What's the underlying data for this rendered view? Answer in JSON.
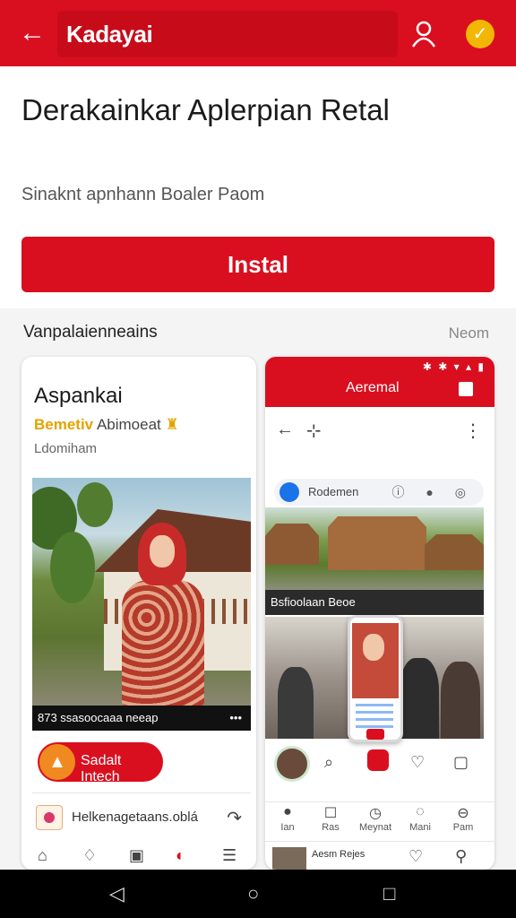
{
  "topbar": {
    "back_icon": "arrow-left-icon",
    "search_text": "Kadayai",
    "user_icon": "user-icon",
    "badge_icon": "check-badge-icon",
    "color": "#d90f1f"
  },
  "header": {
    "title": "Derakainkar Aplerpian Retal",
    "subtitle": "Sinaknt apnhann Boaler Paom",
    "install_label": "Instal"
  },
  "section": {
    "heading": "Vanpalaienneains",
    "more": "Neom"
  },
  "left_card": {
    "title": "Aspankai",
    "tag_gold": "Bemetiv",
    "tag_plain": "Abimoeat",
    "sub": "Ldomiham",
    "caption": "873 ssasoocaaa neeap",
    "caption_menu": "•••",
    "button_label": "Sadalt Intech",
    "link_text": "Helkenagetaans.oblá",
    "share_icon": "share-icon",
    "nav_icons": [
      "home-icon",
      "leaf-icon",
      "box-icon",
      "notification-icon",
      "menu-icon"
    ]
  },
  "right_card": {
    "status": "✱ ✱ ▾ ▴ ▮",
    "title": "Aeremal",
    "bar_back": "←",
    "bar_pin": "⊹",
    "bar_more": "⋮",
    "search_text": "Rodemen",
    "search_icons": "ⓘ ● ◎",
    "caption": "Bsfioolaan Beoe",
    "nav": [
      {
        "icon": "●",
        "label": "Ian"
      },
      {
        "icon": "☐",
        "label": "Ras"
      },
      {
        "icon": "◷",
        "label": "Meynat"
      },
      {
        "icon": "◌",
        "label": "Mani"
      },
      {
        "icon": "⊖",
        "label": "Pam"
      }
    ],
    "bottom_text": "Aesm Rejes"
  },
  "system_nav": {
    "back": "◁",
    "home": "○",
    "recents": "□"
  }
}
